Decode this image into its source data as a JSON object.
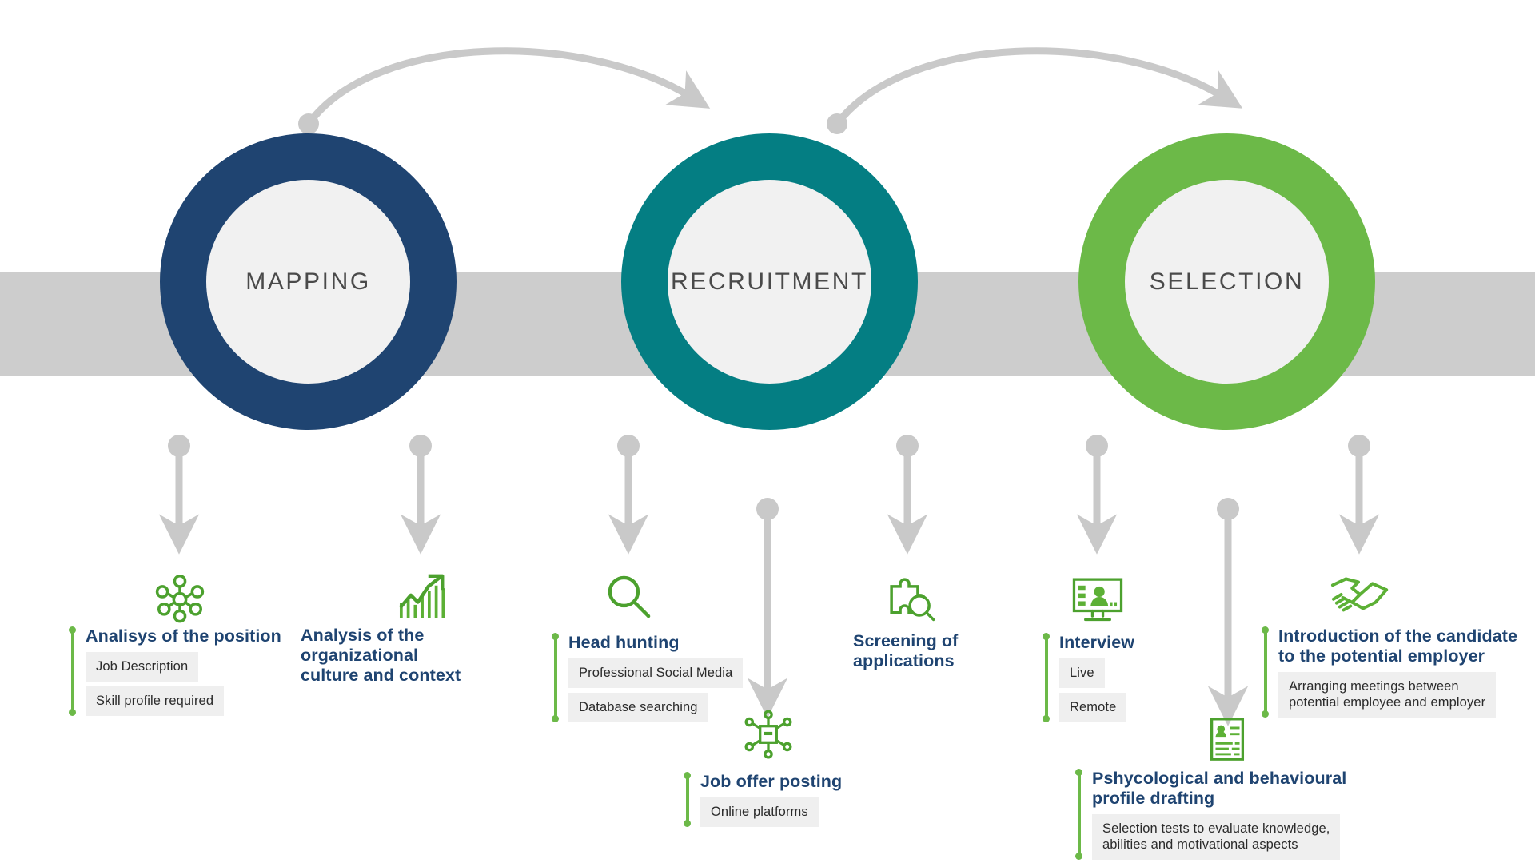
{
  "colors": {
    "navy": "#1f4471",
    "teal": "#047e83",
    "green": "#6cb948",
    "band_grey": "#cdcdcd",
    "arrow_grey": "#c9c9c9",
    "inner_circle": "#f1f1f1",
    "chip_bg": "#efefef",
    "chip_text": "#2b2b2b",
    "ring_label": "#4a4a4a"
  },
  "stages": [
    {
      "id": "mapping",
      "label": "MAPPING",
      "color": "#1f4471"
    },
    {
      "id": "recruitment",
      "label": "RECRUITMENT",
      "color": "#047e83"
    },
    {
      "id": "selection",
      "label": "SELECTION",
      "color": "#6cb948"
    }
  ],
  "tasks": [
    {
      "id": "analysis-of-the-position",
      "title": "Analisys of the position",
      "icon": "network-nodes-icon",
      "chips": [
        "Job Description",
        "Skill profile required"
      ]
    },
    {
      "id": "analysis-of-culture",
      "title": "Analysis of the organizational\nculture and context",
      "icon": "growth-chart-icon",
      "chips": []
    },
    {
      "id": "head-hunting",
      "title": "Head hunting",
      "icon": "magnifier-icon",
      "chips": [
        "Professional Social Media",
        "Database searching"
      ]
    },
    {
      "id": "job-offer-posting",
      "title": "Job offer posting",
      "icon": "broadcast-network-icon",
      "chips": [
        "Online platforms"
      ]
    },
    {
      "id": "screening-of-applications",
      "title": "Screening of\napplications",
      "icon": "puzzle-magnifier-icon",
      "chips": []
    },
    {
      "id": "interview",
      "title": "Interview",
      "icon": "video-interview-icon",
      "chips": [
        "Live",
        "Remote"
      ]
    },
    {
      "id": "psychological-profile",
      "title": "Pshycological and behavioural\nprofile drafting",
      "icon": "resume-document-icon",
      "chips": [
        "Selection tests to evaluate knowledge,\nabilities and motivational aspects"
      ]
    },
    {
      "id": "introduction-of-candidate",
      "title": "Introduction of the candidate\nto the potential employer",
      "icon": "handshake-icon",
      "chips": [
        "Arranging meetings between\npotential employee and employer"
      ]
    }
  ]
}
